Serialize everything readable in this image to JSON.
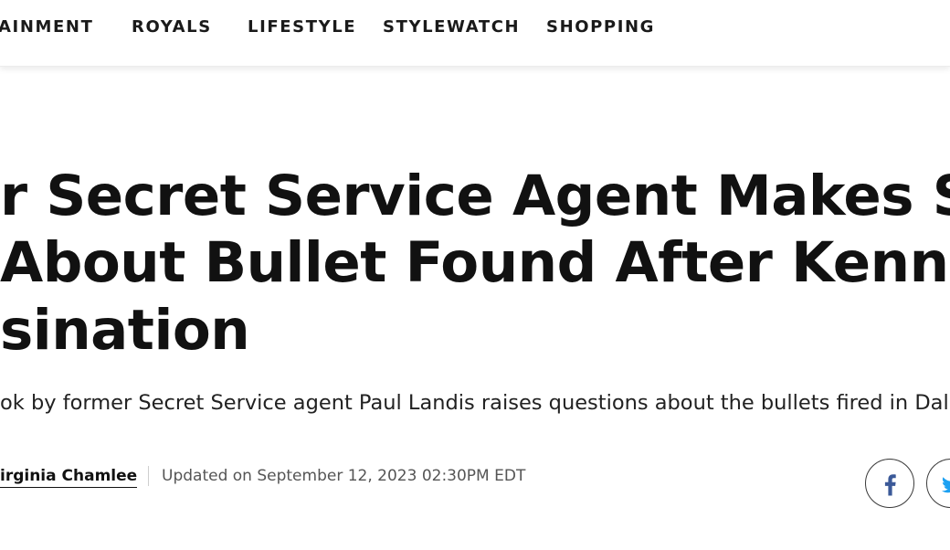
{
  "nav": {
    "items": [
      {
        "label": "AINMENT"
      },
      {
        "label": "ROYALS"
      },
      {
        "label": "LIFESTYLE"
      },
      {
        "label": "STYLEWATCH"
      },
      {
        "label": "SHOPPING"
      }
    ]
  },
  "article": {
    "headline_lines": [
      "r Secret Service Agent Makes Star",
      " About Bullet Found After Kennedy",
      "sination"
    ],
    "subhead": "ok by former Secret Service agent Paul Landis raises questions about the bullets fired in Dalla",
    "byline": {
      "author": "irginia Chamlee",
      "updated": "Updated on September 12, 2023 02:30PM EDT"
    }
  },
  "share": {
    "facebook_icon": "facebook-icon",
    "twitter_icon": "twitter-icon",
    "facebook_color": "#3b5998",
    "twitter_color": "#1da1f2"
  }
}
